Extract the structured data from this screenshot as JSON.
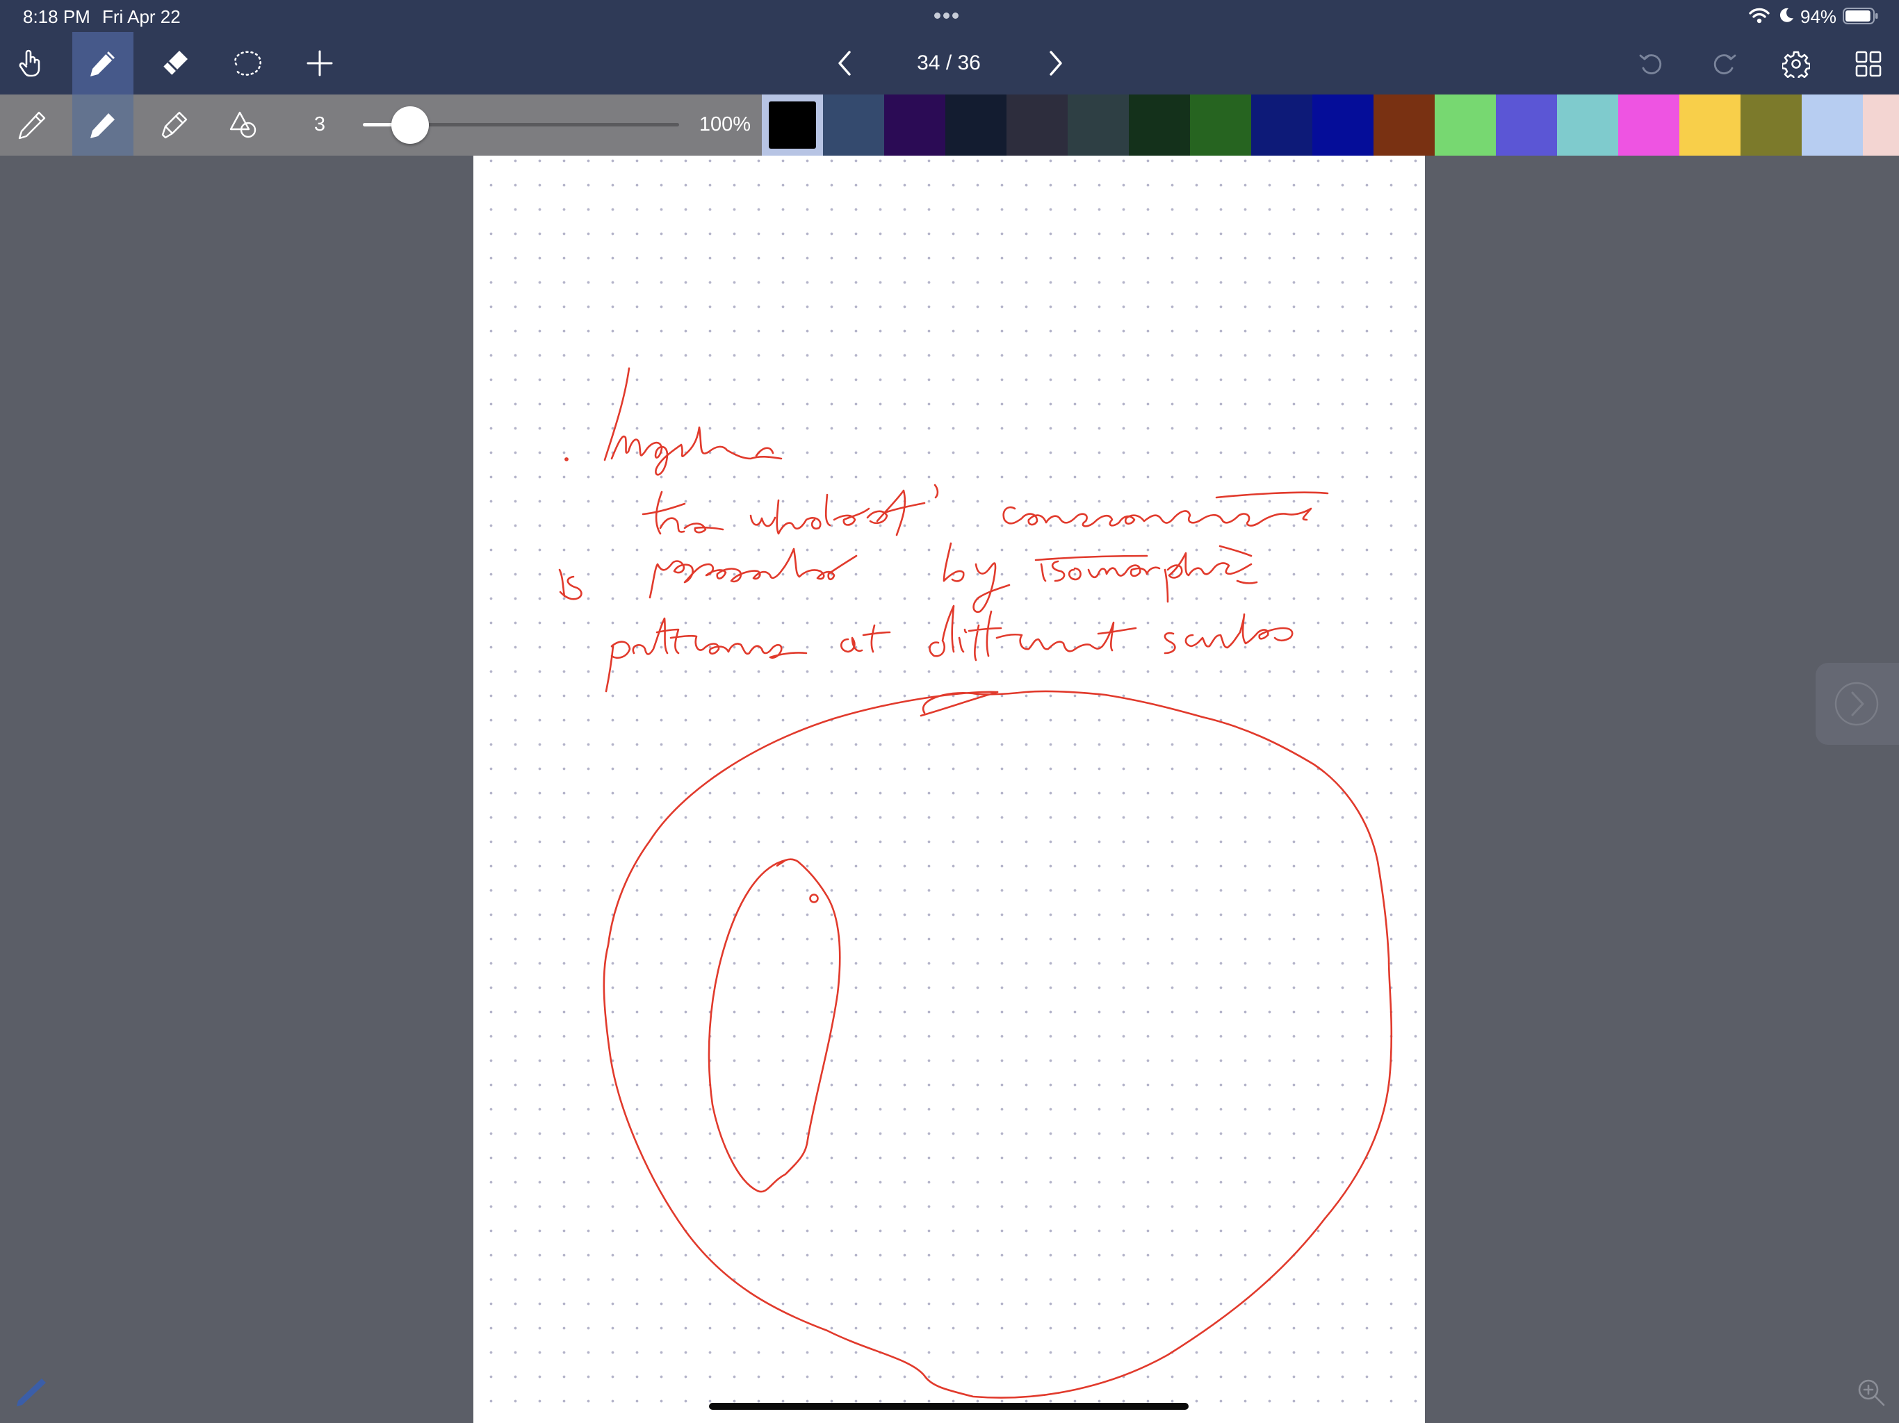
{
  "status_bar": {
    "time": "8:18 PM",
    "date": "Fri Apr 22",
    "battery_percent": "94%",
    "battery_level": 0.94,
    "icons": [
      "wifi-icon",
      "moon-icon",
      "battery-icon",
      "more-dots-icon"
    ]
  },
  "toolbar": {
    "tools": [
      "hand-icon",
      "pen-icon",
      "eraser-icon",
      "lasso-icon",
      "add-icon"
    ],
    "active_tool": "pen",
    "page_indicator": "34 / 36",
    "right_icons": [
      "undo-icon",
      "redo-icon",
      "settings-icon",
      "grid-icon"
    ]
  },
  "pen_settings": {
    "styles": [
      "fountain-pen-icon",
      "ballpoint-pen-icon",
      "highlighter-icon",
      "shapes-icon"
    ],
    "active_style": "ballpoint",
    "size": "3",
    "size_level": 0.15,
    "opacity": "100%"
  },
  "palette": {
    "selected": "#000000",
    "colors": [
      "#000000",
      "#344a6e",
      "#2b0b55",
      "#131c30",
      "#2d2d3d",
      "#2e3f44",
      "#14311b",
      "#266420",
      "#0d1a78",
      "#050d99",
      "#793112",
      "#77d871",
      "#5b56d5",
      "#7fcbcd",
      "#ee54e2",
      "#f8cf4a",
      "#7c7a2b",
      "#b7cdf1",
      "#f3d5d2"
    ]
  },
  "page": {
    "ink_color": "#e13a2c",
    "handwriting_lines": [
      "Imagine",
      "the whole of consciousness",
      "is represented by isomorphic",
      "patterns at different scales"
    ]
  },
  "overlay": {
    "icons": [
      "chevron-right-icon",
      "pencil-indicator-icon",
      "zoom-in-icon"
    ]
  }
}
